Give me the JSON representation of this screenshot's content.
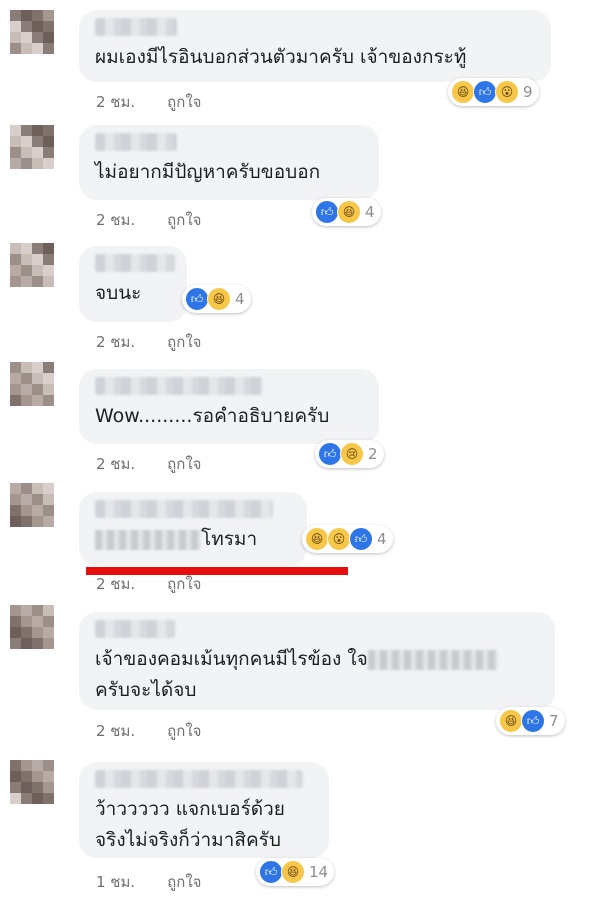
{
  "colors": {
    "bubble": "#f2f3f5",
    "like": "#2e76e8",
    "emoji": "#f7c74a",
    "underline": "#e80d0d"
  },
  "comments": [
    {
      "lines": [
        "ผมเองมีไรอินบอกส่วนตัวมาครับ เจ้าของกระทู้"
      ],
      "time": "2 ชม.",
      "like_label": "ถูกใจ",
      "reactions": [
        "haha",
        "like",
        "wow"
      ],
      "count": "9"
    },
    {
      "lines": [
        "ไม่อยากมีปัญหาครับขอบอก"
      ],
      "time": "2 ชม.",
      "like_label": "ถูกใจ",
      "reactions": [
        "like",
        "haha"
      ],
      "count": "4"
    },
    {
      "lines": [
        "จบนะ"
      ],
      "time": "2 ชม.",
      "like_label": "ถูกใจ",
      "reactions": [
        "like",
        "haha"
      ],
      "count": "4"
    },
    {
      "lines": [
        "Wow.........รอคำอธิบายครับ"
      ],
      "time": "2 ชม.",
      "like_label": "ถูกใจ",
      "reactions": [
        "like",
        "sad"
      ],
      "count": "2"
    },
    {
      "lines": [
        "โทรมา"
      ],
      "time": "2 ชม.",
      "like_label": "ถูกใจ",
      "reactions": [
        "haha",
        "wow",
        "like"
      ],
      "count": "4"
    },
    {
      "lines": [
        "เจ้าของคอมเม้นทุกคนมีไรข้อง ใจ",
        "ครับจะได้จบ"
      ],
      "time": "2 ชม.",
      "like_label": "ถูกใจ",
      "reactions": [
        "haha",
        "like"
      ],
      "count": "7"
    },
    {
      "lines": [
        "ว้าววววว แจกเบอร์ด้วย",
        "จริงไม่จริงก็ว่ามาสิครับ"
      ],
      "time": "1 ชม.",
      "like_label": "ถูกใจ",
      "reactions": [
        "like",
        "haha"
      ],
      "count": "14"
    }
  ]
}
